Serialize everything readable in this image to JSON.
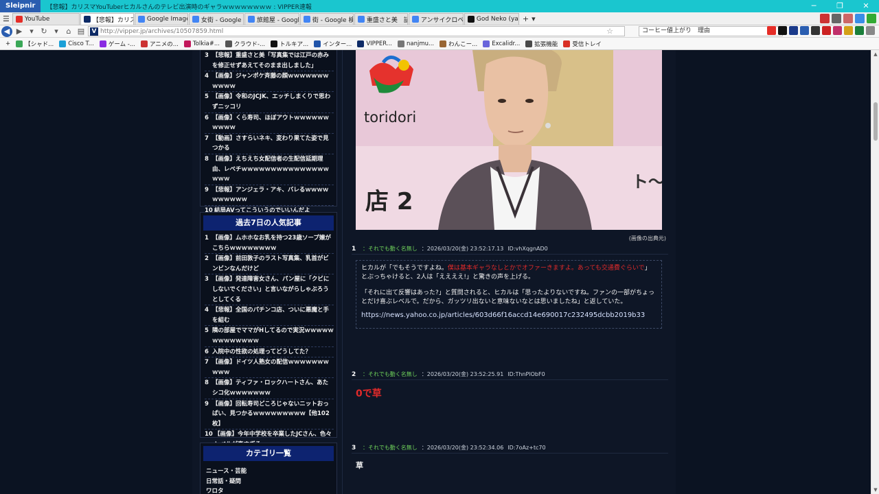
{
  "browser": {
    "app_name": "Sleipnir",
    "window_title": "【悲報】カリスマYouTuberヒカルさんのテレビ出演時のギャラｗｗｗｗｗｗｗｗ : VIPPER速報",
    "url": "http://vipper.jp/archives/10507859.html",
    "search_text": "コーヒー値上がり　理由",
    "tabs": [
      {
        "label": "YouTube",
        "color": "#e52d27"
      },
      {
        "label": "【悲報】カリスマYo...",
        "color": "#0d2a66"
      },
      {
        "label": "Google Image R...",
        "color": "#4285f4"
      },
      {
        "label": "女街 - Google ...",
        "color": "#4285f4"
      },
      {
        "label": "旅館屋 - Googl...",
        "color": "#4285f4"
      },
      {
        "label": "街 - Google 検索",
        "color": "#4285f4"
      },
      {
        "label": "重盛さと美　証...",
        "color": "#4285f4"
      },
      {
        "label": "アンサイクロペディ...",
        "color": "#4285f4"
      },
      {
        "label": "God Neko (yaye...",
        "color": "#111111"
      }
    ],
    "bookmarks": [
      {
        "label": "【シャド...",
        "color": "#3aa757"
      },
      {
        "label": "Cisco T...",
        "color": "#1ba0d7"
      },
      {
        "label": "ゲーム -...",
        "color": "#8a2be2"
      },
      {
        "label": "アニメの...",
        "color": "#cc3333"
      },
      {
        "label": "Tolkia#...",
        "color": "#c2185b"
      },
      {
        "label": "クラウド-...",
        "color": "#555555"
      },
      {
        "label": "トルキア...",
        "color": "#111111"
      },
      {
        "label": "インター...",
        "color": "#2255aa"
      },
      {
        "label": "VIPPER...",
        "color": "#0d2a66"
      },
      {
        "label": "nanjmu...",
        "color": "#777777"
      },
      {
        "label": "わんこー...",
        "color": "#996633"
      },
      {
        "label": "Excalidr...",
        "color": "#6965db"
      },
      {
        "label": "拡張機能",
        "color": "#4a4a4a"
      },
      {
        "label": "受信トレイ",
        "color": "#d93025"
      }
    ]
  },
  "sidebar": {
    "top_ranking": [
      {
        "no": "3",
        "text": "【悲報】重盛さと美「写真集では江戸の赤みを修正せずあえてそのまま出しました」"
      },
      {
        "no": "4",
        "text": "【画像】ジャンポケ斉藤の顔ｗｗｗｗｗｗｗｗｗｗｗ"
      },
      {
        "no": "5",
        "text": "【画像】令和のJCJK、エッチしまくりで思わずニッコリ"
      },
      {
        "no": "6",
        "text": "【画像】くら寿司、ほぼアウトｗｗｗｗｗｗｗｗｗｗ"
      },
      {
        "no": "7",
        "text": "【動画】さすらいネキ、変わり果てた姿で見つかる"
      },
      {
        "no": "8",
        "text": "【画像】えちえち女配信者の生配信延期理由、レベチｗｗｗｗｗｗｗｗｗｗｗｗｗｗｗｗｗｗ"
      },
      {
        "no": "9",
        "text": "【悲報】アンジェラ・アキ、バレるｗｗｗｗｗｗｗｗｗｗ"
      },
      {
        "no": "10",
        "text": "結局AVってこういうのでいいんだよ"
      }
    ],
    "weekly_title": "過去7日の人気記事",
    "weekly": [
      {
        "no": "1",
        "text": "【画像】ムホホなお乳を持つ23歳ソープ嬢がこちらｗｗｗｗｗｗｗｗ"
      },
      {
        "no": "2",
        "text": "【画像】前田敦子のラスト写真集、乳首がビンビンなんだけど"
      },
      {
        "no": "3",
        "text": "【画像】発達障害女さん、パン屋に「クビにしないでください」と言いながらしゃぶろうとしてくる"
      },
      {
        "no": "4",
        "text": "【悲報】全国のパチンコ店、ついに悪魔と手を組む"
      },
      {
        "no": "5",
        "text": "隣の部屋でママがHしてるので実況ｗｗｗｗｗｗｗｗｗｗｗｗｗ"
      },
      {
        "no": "6",
        "text": "入院中の性欲の処理ってどうしてた？"
      },
      {
        "no": "7",
        "text": "【画像】ドイツ人熟女の配信ｗｗｗｗｗｗｗｗｗｗ"
      },
      {
        "no": "8",
        "text": "【画像】ティファ・ロックハートさん、あたシコ化ｗｗｗｗｗｗｗ"
      },
      {
        "no": "9",
        "text": "【画像】回転寿司どころじゃないニットおっぱい、見つかるｗｗｗｗｗｗｗｗｗ【他102枚】"
      },
      {
        "no": "10",
        "text": "【画像】今年中学校を卒業したJCさん、色々レベルが高すぎる"
      }
    ],
    "category_title": "カテゴリ一覧",
    "categories": [
      "ニュース・芸能",
      "日常話・疑問",
      "ワロタ"
    ]
  },
  "article": {
    "photo_brand": "toridori",
    "photo_banner": "店 2",
    "photo_banner_right": "ト〜",
    "image_credit": "(画像の出典元)",
    "posts": [
      {
        "no": "1",
        "name": "：それでも動く名無し",
        "date": "：2026/03/20(金) 23:52:17.13",
        "id": "ID:vhXqgnAD0",
        "text_a": "ヒカルが「でもそうですよね。",
        "text_red": "僕は基本ギャラなしとかでオファーきますよ。あっても交通費ぐらいで",
        "text_b": "」とぶっちゃけると、2人は「ええええ!」と驚きの声を上げる。",
        "text_c": "「それに出て反響はあった?」と質問されると、ヒカルは「思ったよりないですね。ファンの一部がちょっとだけ喜ぶレベルで。だから、ガッツリ出ないと意味ないなとは思いましたね」と返していた。",
        "link": "https://news.yahoo.co.jp/articles/603d66f16accd14e690017c232495dcbb2019b33"
      },
      {
        "no": "2",
        "name": "：それでも動く名無し",
        "date": "：2026/03/20(金) 23:52:25.91",
        "id": "ID:ThnPlObF0",
        "body": "0で草"
      },
      {
        "no": "3",
        "name": "：それでも動く名無し",
        "date": "：2026/03/20(金) 23:52:34.06",
        "id": "ID:7oAz+tc70",
        "body": "草"
      }
    ]
  }
}
